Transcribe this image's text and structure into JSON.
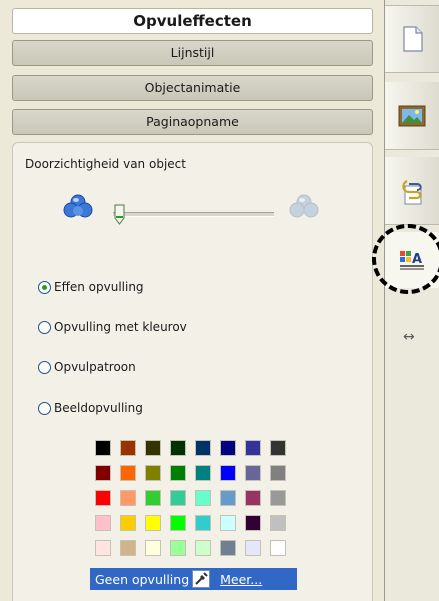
{
  "accordion": {
    "active_title": "Opvuleffecten",
    "sections": [
      "Lijnstijl",
      "Objectanimatie",
      "Paginaopname"
    ]
  },
  "transparency": {
    "label": "Doorzichtigheid van object",
    "value": 0
  },
  "fill_options": {
    "solid": "Effen opvulling",
    "gradient": "Opvulling met kleurov",
    "pattern": "Opvulpatroon",
    "image": "Beeldopvulling",
    "selected": "solid"
  },
  "palette": {
    "rows": [
      [
        "#000000",
        "#993300",
        "#333300",
        "#003300",
        "#003366",
        "#000080",
        "#333399",
        "#333333"
      ],
      [
        "#800000",
        "#ff6600",
        "#808000",
        "#008000",
        "#008080",
        "#0000ff",
        "#666699",
        "#808080"
      ],
      [
        "#ff0000",
        "#ff9966",
        "#33cc33",
        "#33cc99",
        "#66ffcc",
        "#6699cc",
        "#993366",
        "#999999"
      ],
      [
        "#ffc0cb",
        "#ffcc00",
        "#ffff00",
        "#00ff00",
        "#33cccc",
        "#ccffff",
        "#330033",
        "#c0c0c0"
      ],
      [
        "#ffe4e1",
        "#d2b48c",
        "#ffffe0",
        "#99ff99",
        "#ccffcc",
        "#708090",
        "#e6e6fa",
        "#ffffff"
      ]
    ],
    "no_fill_label": "Geen opvulling",
    "more_label": "Meer..."
  },
  "sidebar": {
    "tabs": [
      "page-sorter-icon",
      "gallery-icon",
      "attachments-icon",
      "properties-icon"
    ],
    "resize": "↔"
  },
  "colors": {
    "panel_bg": "#ece9d8",
    "selection_blue": "#3168c6",
    "radio_green": "#21a121"
  }
}
